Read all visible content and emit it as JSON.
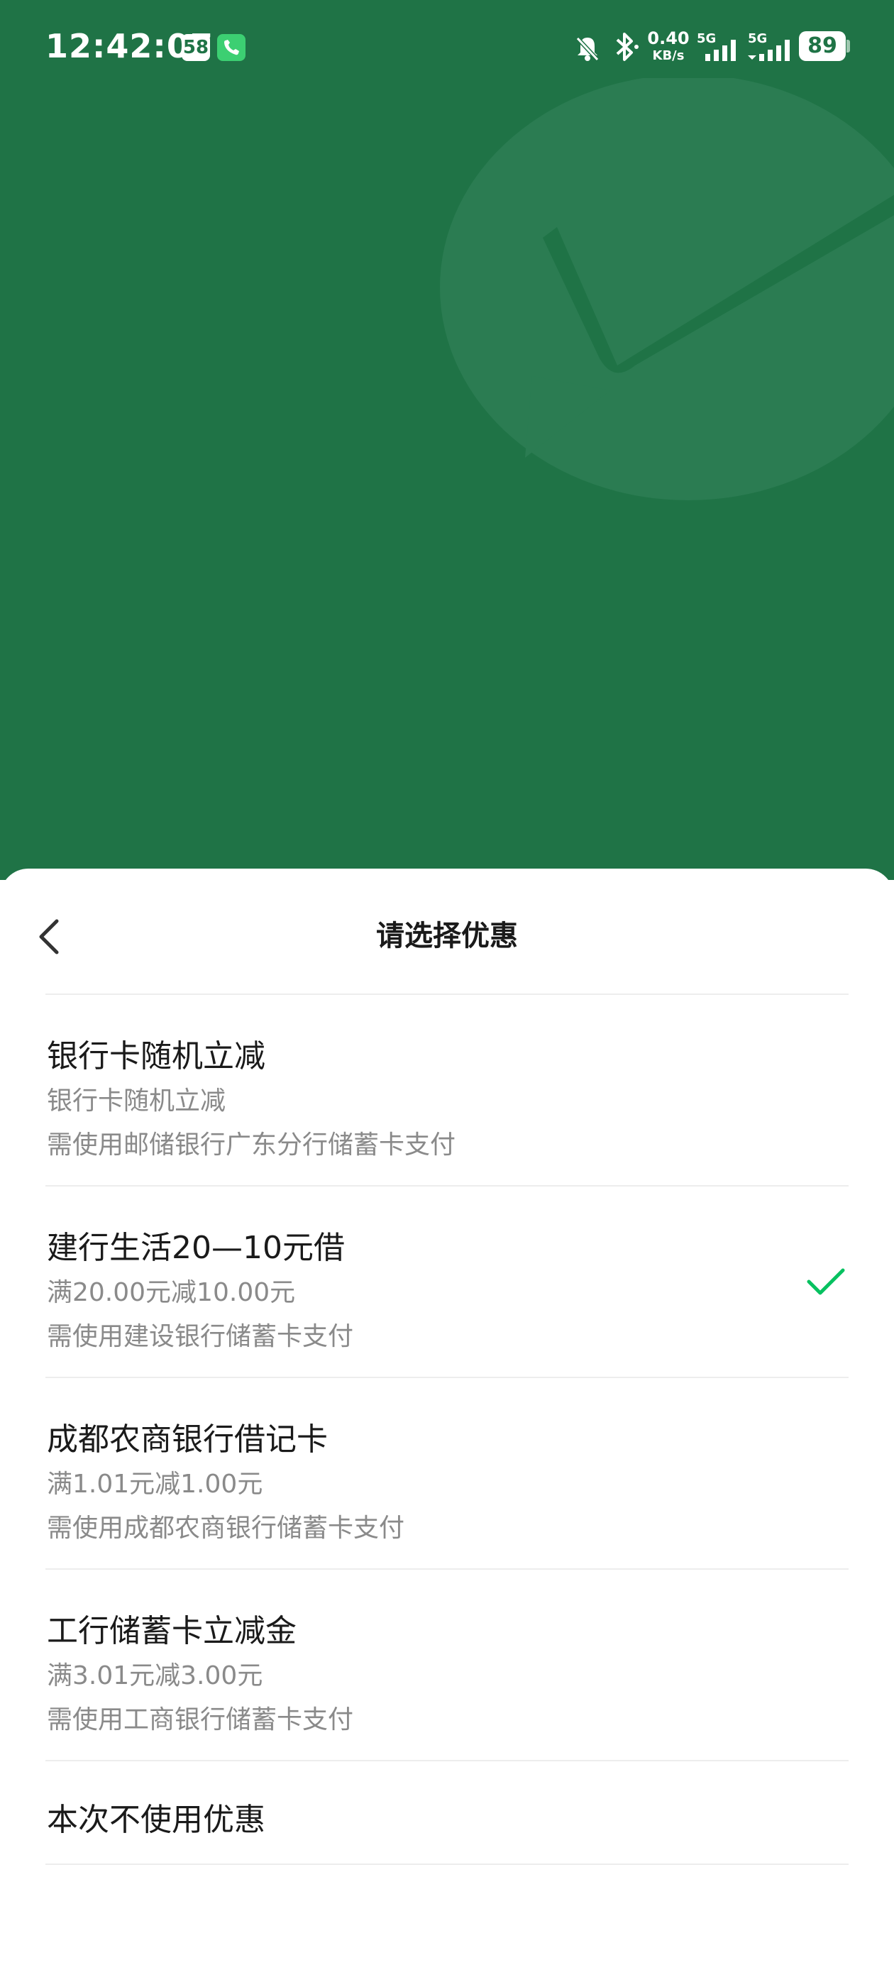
{
  "status_bar": {
    "time": "12:42:07",
    "badge": "58",
    "net_speed_value": "0.40",
    "net_speed_unit": "KB/s",
    "signal1_label": "5G",
    "signal2_label": "5G",
    "battery": "89"
  },
  "sheet": {
    "title": "请选择优惠",
    "options": [
      {
        "title": "银行卡随机立减",
        "line1": "银行卡随机立减",
        "line2": "需使用邮储银行广东分行储蓄卡支付",
        "selected": false
      },
      {
        "title": "建行生活20—10元借",
        "line1": "满20.00元减10.00元",
        "line2": "需使用建设银行储蓄卡支付",
        "selected": true
      },
      {
        "title": "成都农商银行借记卡",
        "line1": "满1.01元减1.00元",
        "line2": "需使用成都农商银行储蓄卡支付",
        "selected": false
      },
      {
        "title": "工行储蓄卡立减金",
        "line1": "满3.01元减3.00元",
        "line2": "需使用工商银行储蓄卡支付",
        "selected": false
      },
      {
        "title": "本次不使用优惠",
        "selected": false
      }
    ]
  },
  "colors": {
    "brand_green": "#1f7346",
    "check_green": "#07c160",
    "text_primary": "#1a1a1a",
    "text_secondary": "#8a8a8a"
  },
  "icons": {
    "back": "chevron-left-icon",
    "selected": "checkmark-icon",
    "background_logo": "wechat-pay-logo",
    "mute": "bell-off-icon",
    "bluetooth": "bluetooth-icon",
    "call": "phone-icon"
  }
}
